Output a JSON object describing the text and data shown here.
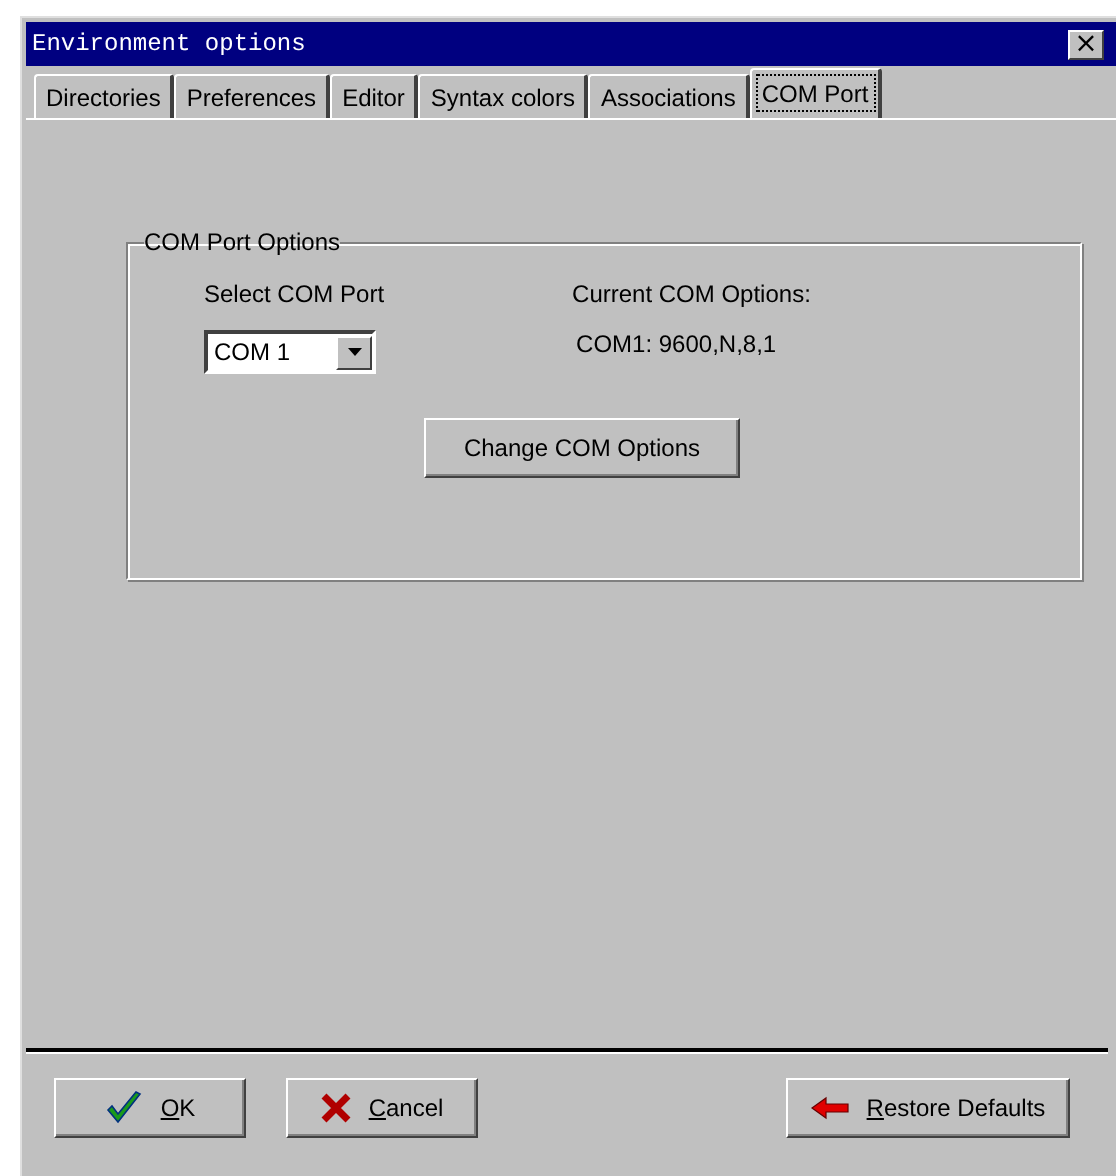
{
  "window": {
    "title": "Environment options",
    "close_label": "×"
  },
  "tabs": [
    {
      "label": "Directories",
      "selected": false
    },
    {
      "label": "Preferences",
      "selected": false
    },
    {
      "label": "Editor",
      "selected": false
    },
    {
      "label": "Syntax colors",
      "selected": false
    },
    {
      "label": "Associations",
      "selected": false
    },
    {
      "label": "COM Port",
      "selected": true
    }
  ],
  "group": {
    "title": "COM Port Options",
    "select_label": "Select COM Port",
    "select_value": "COM 1",
    "current_label": "Current COM Options:",
    "current_value": "COM1: 9600,N,8,1",
    "change_button": "Change COM Options"
  },
  "buttons": [
    {
      "kind": "ok",
      "label": "OK",
      "mnemonic": true
    },
    {
      "kind": "cancel",
      "label": "Cancel",
      "mnemonic": true
    },
    {
      "kind": "restore",
      "label": "Restore Defaults",
      "mnemonic": true
    }
  ]
}
